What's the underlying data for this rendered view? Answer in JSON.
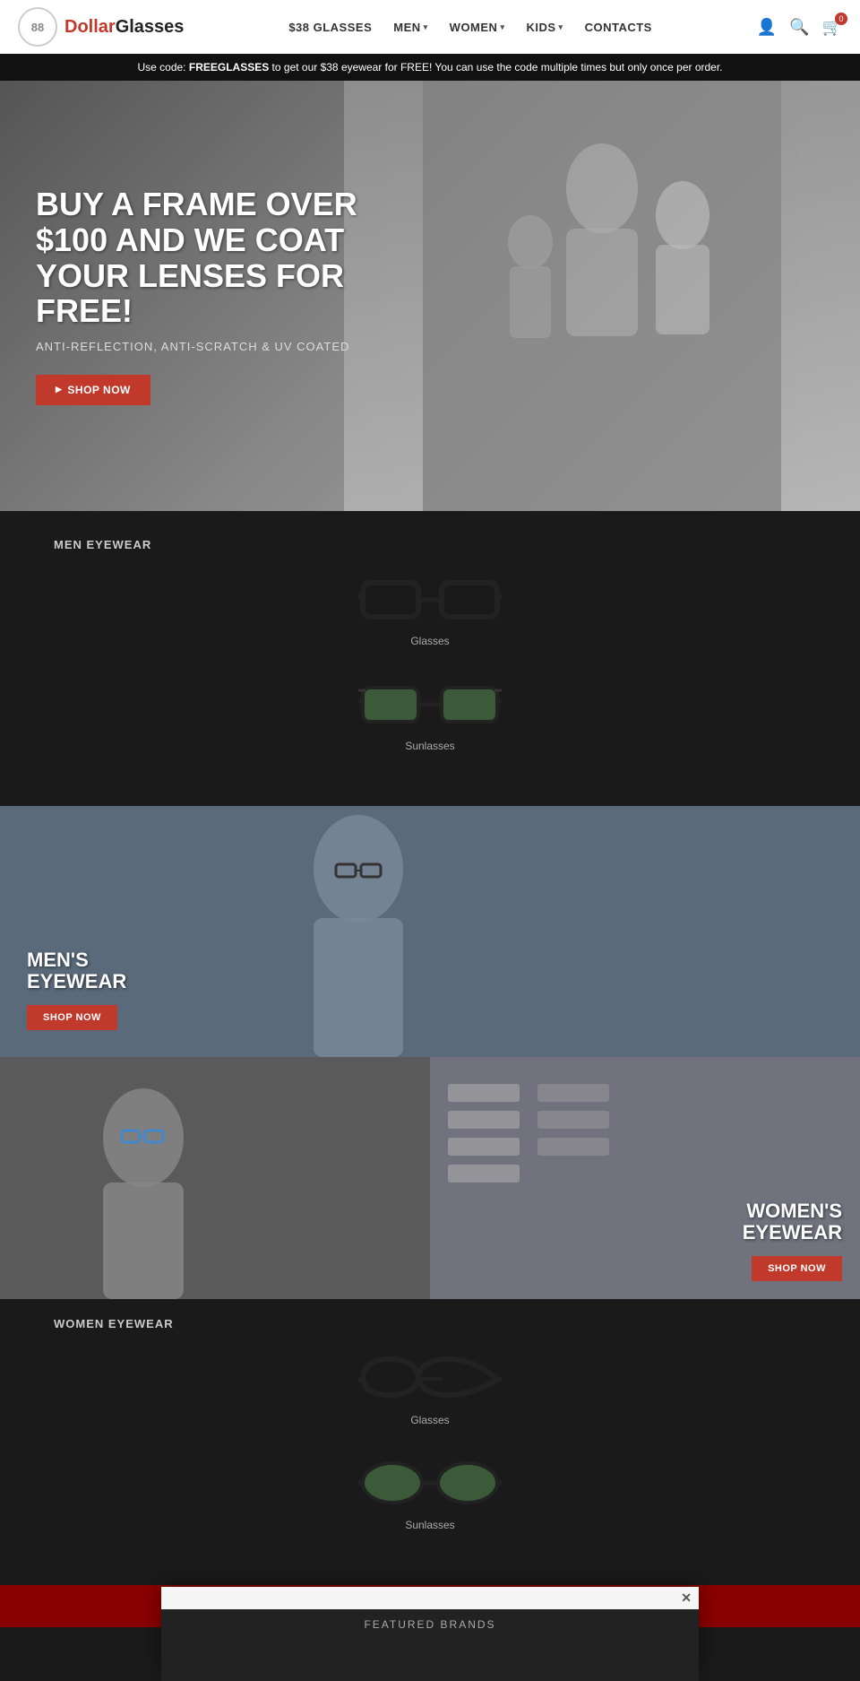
{
  "header": {
    "logo": {
      "symbol": "88",
      "brand_first": "Dollar",
      "brand_second": "Glasses"
    },
    "nav": [
      {
        "label": "$38 GLASSES",
        "has_dropdown": false,
        "active": false
      },
      {
        "label": "MEN",
        "has_dropdown": true,
        "active": false
      },
      {
        "label": "WOMEN",
        "has_dropdown": true,
        "active": false
      },
      {
        "label": "KIDS",
        "has_dropdown": true,
        "active": false
      },
      {
        "label": "CONTACTS",
        "has_dropdown": false,
        "active": false
      }
    ],
    "icons": {
      "account": "👤",
      "search": "🔍",
      "cart": "🛒",
      "cart_count": "0"
    }
  },
  "promo_bar": {
    "text_before": "Use code: ",
    "code": "FREEGLASSES",
    "text_after": " to get our $38 eyewear for FREE! You can use the code multiple times but only once per order."
  },
  "hero": {
    "title": "BUY A FRAME OVER $100 AND WE COAT YOUR LENSES FOR FREE!",
    "subtitle": "ANTI-REFLECTION, ANTI-SCRATCH & UV COATED",
    "cta_label": "SHOP NOW"
  },
  "men_eyewear": {
    "section_title": "MEN EYEWEAR",
    "items": [
      {
        "label": "Glasses",
        "type": "clear"
      },
      {
        "label": "Sunlasses",
        "type": "dark"
      }
    ]
  },
  "banner_men": {
    "tag_line1": "MEN'S",
    "tag_line2": "EYEWEAR",
    "cta_label": "SHOP NOW"
  },
  "banner_women": {
    "tag_line1": "WOMEN'S",
    "tag_line2": "EYEWEAR",
    "cta_label": "SHOP NOW"
  },
  "women_eyewear": {
    "section_title": "WOMEN EYEWEAR",
    "items": [
      {
        "label": "Glasses",
        "type": "clear"
      },
      {
        "label": "Sunlasses",
        "type": "dark"
      }
    ]
  },
  "featured_brands": {
    "title": "FEATURED BRANDS"
  },
  "popup": {
    "close_label": "✕",
    "featured_title": "FEATURED BRANDS"
  }
}
